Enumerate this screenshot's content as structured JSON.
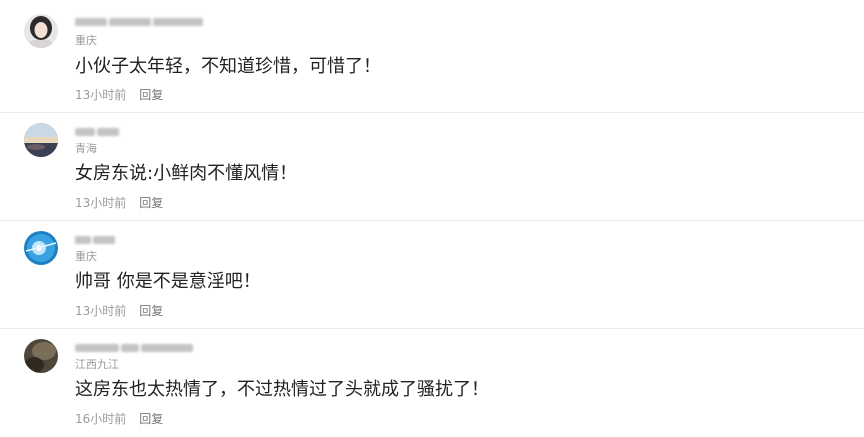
{
  "comments": [
    {
      "avatar_icon": "avatar-woman-photo",
      "location": "重庆",
      "content": "小伙子太年轻，不知道珍惜，可惜了！",
      "time": "13小时前",
      "reply_label": "回复"
    },
    {
      "avatar_icon": "avatar-landscape-photo",
      "location": "青海",
      "content": "女房东说:小鲜肉不懂风情！",
      "time": "13小时前",
      "reply_label": "回复"
    },
    {
      "avatar_icon": "avatar-blue-light-photo",
      "location": "重庆",
      "content": "帅哥 你是不是意淫吧！",
      "time": "13小时前",
      "reply_label": "回复"
    },
    {
      "avatar_icon": "avatar-dark-photo",
      "location": "江西九江",
      "content": "这房东也太热情了，不过热情过了头就成了骚扰了！",
      "time": "16小时前",
      "reply_label": "回复"
    }
  ]
}
